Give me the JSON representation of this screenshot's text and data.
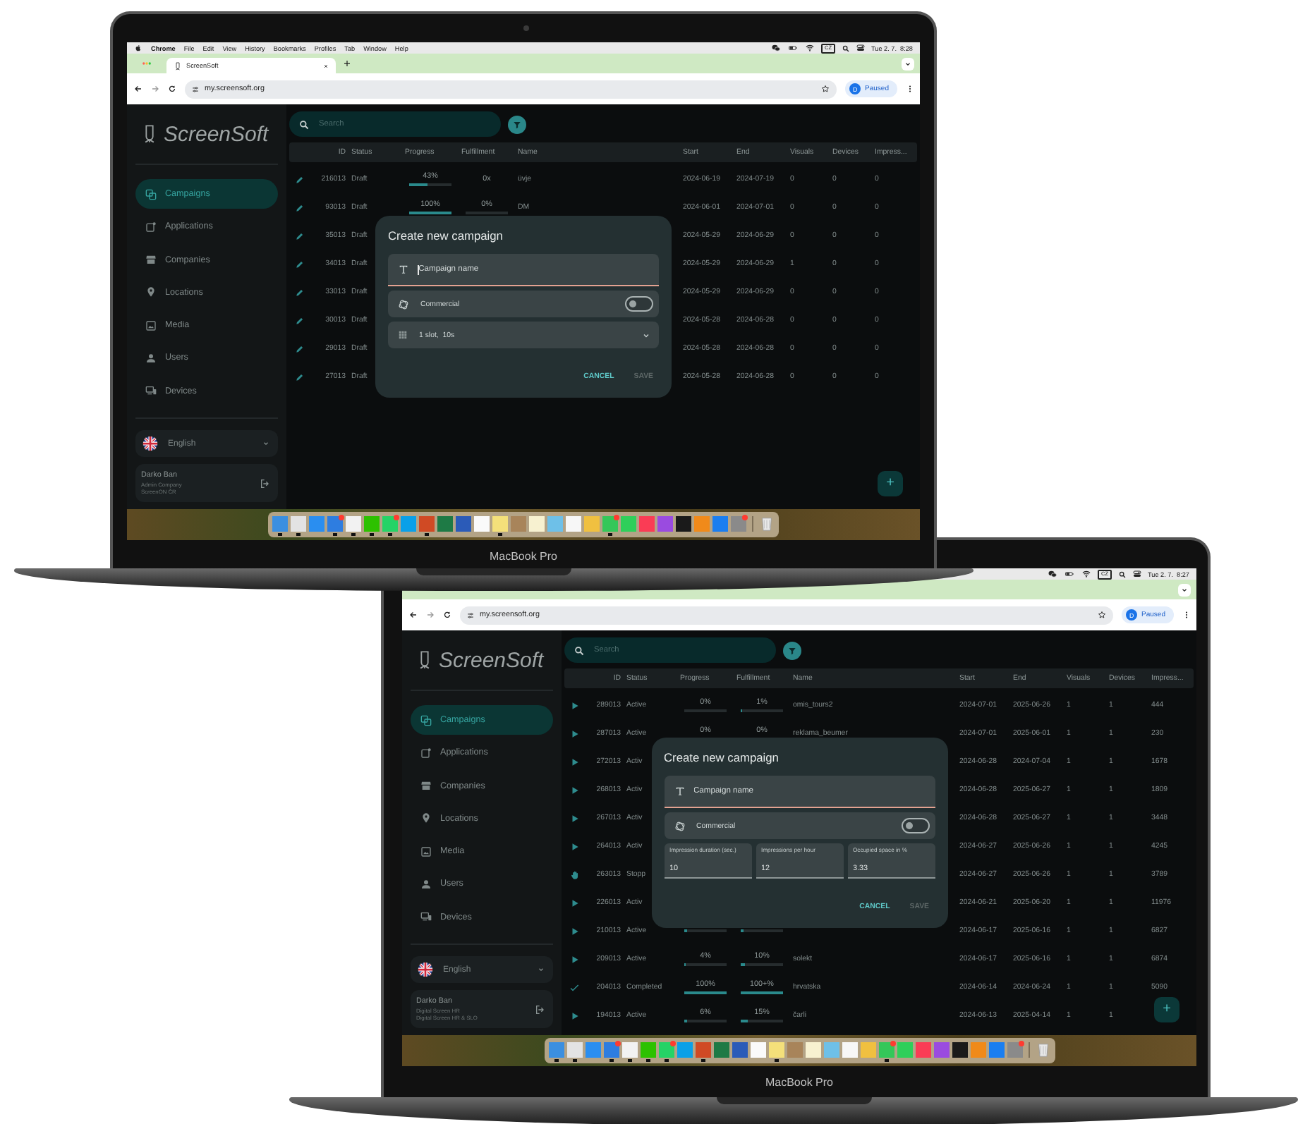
{
  "laptops": [
    {
      "model": "MacBook Pro",
      "menu_bar": {
        "menus": [
          "Chrome",
          "File",
          "Edit",
          "View",
          "History",
          "Bookmarks",
          "Profiles",
          "Tab",
          "Window",
          "Help"
        ],
        "input_source": "CZ",
        "clock": "Tue 2. 7.  8:28"
      },
      "browser": {
        "tabs": [
          {
            "title": "ScreenSoft",
            "selected": true
          }
        ],
        "url": "my.screensoft.org",
        "profile": {
          "initial": "D",
          "label": "Paused"
        }
      },
      "app": {
        "logo": "ScreenSoft",
        "nav": [
          {
            "label": "Campaigns",
            "selected": true
          },
          {
            "label": "Applications",
            "selected": false
          },
          {
            "label": "Companies",
            "selected": false
          },
          {
            "label": "Locations",
            "selected": false
          },
          {
            "label": "Media",
            "selected": false
          },
          {
            "label": "Users",
            "selected": false
          },
          {
            "label": "Devices",
            "selected": false
          }
        ],
        "language": "English",
        "user": {
          "name": "Darko Ban",
          "lines": [
            "Admin Company",
            "ScreenON ČR"
          ]
        },
        "search": {
          "placeholder": "Search"
        },
        "table": {
          "columns": [
            "ID",
            "Status",
            "Progress",
            "Fulfillment",
            "Name",
            "Start",
            "End",
            "Visuals",
            "Devices",
            "Impress..."
          ],
          "rows": [
            {
              "kind": "draft",
              "id": "216013",
              "status": "Draft",
              "progress": {
                "text": "43%",
                "level": 0.43
              },
              "fulfillment": {
                "text": "0x"
              },
              "name": "üvje",
              "start": "2024-06-19",
              "end": "2024-07-19",
              "visuals": "0",
              "devices": "0",
              "impressions": "0"
            },
            {
              "kind": "draft",
              "id": "93013",
              "status": "Draft",
              "progress": {
                "text": "100%",
                "level": 1
              },
              "fulfillment": {
                "text": "0%",
                "level": 0
              },
              "name": "DM",
              "start": "2024-06-01",
              "end": "2024-07-01",
              "visuals": "0",
              "devices": "0",
              "impressions": "0"
            },
            {
              "kind": "draft",
              "id": "35013",
              "status": "Draft",
              "start": "2024-05-29",
              "end": "2024-06-29",
              "visuals": "0",
              "devices": "0",
              "impressions": "0"
            },
            {
              "kind": "draft",
              "id": "34013",
              "status": "Draft",
              "start": "2024-05-29",
              "end": "2024-06-29",
              "visuals": "1",
              "devices": "0",
              "impressions": "0"
            },
            {
              "kind": "draft",
              "id": "33013",
              "status": "Draft",
              "start": "2024-05-29",
              "end": "2024-06-29",
              "visuals": "0",
              "devices": "0",
              "impressions": "0"
            },
            {
              "kind": "draft",
              "id": "30013",
              "status": "Draft",
              "start": "2024-05-28",
              "end": "2024-06-28",
              "visuals": "0",
              "devices": "0",
              "impressions": "0"
            },
            {
              "kind": "draft",
              "id": "29013",
              "status": "Draft",
              "start": "2024-05-28",
              "end": "2024-06-28",
              "visuals": "0",
              "devices": "0",
              "impressions": "0"
            },
            {
              "kind": "draft",
              "id": "27013",
              "status": "Draft",
              "start": "2024-05-28",
              "end": "2024-06-28",
              "visuals": "0",
              "devices": "0",
              "impressions": "0"
            }
          ]
        },
        "dialog": {
          "title": "Create new campaign",
          "fields": [
            {
              "kind": "text",
              "placeholder": "Campaign name",
              "focused": true
            },
            {
              "kind": "switch",
              "label": "Commercial",
              "on": false
            },
            {
              "kind": "select",
              "value": "1 slot,  10s"
            }
          ],
          "actions": [
            {
              "label": "CANCEL",
              "disabled": false
            },
            {
              "label": "SAVE",
              "disabled": true
            }
          ]
        },
        "fab": {
          "symbol": "+"
        }
      },
      "dock": {
        "apps": [
          {
            "running": true,
            "badge": false
          },
          {
            "running": true,
            "badge": false
          },
          {
            "running": false,
            "badge": false
          },
          {
            "running": true,
            "badge": true
          },
          {
            "running": true,
            "badge": false
          },
          {
            "running": true,
            "badge": false
          },
          {
            "running": true,
            "badge": true
          },
          {
            "running": false,
            "badge": false
          },
          {
            "running": true,
            "badge": false
          },
          {
            "running": false,
            "badge": false
          },
          {
            "running": false,
            "badge": false
          },
          {
            "running": false,
            "badge": false
          },
          {
            "running": true,
            "badge": false
          },
          {
            "running": false,
            "badge": false
          },
          {
            "running": false,
            "badge": false
          },
          {
            "running": false,
            "badge": false
          },
          {
            "running": false,
            "badge": false
          },
          {
            "running": false,
            "badge": false
          },
          {
            "running": true,
            "badge": true
          },
          {
            "running": false,
            "badge": false
          },
          {
            "running": false,
            "badge": false
          },
          {
            "running": false,
            "badge": false
          },
          {
            "running": false,
            "badge": false
          },
          {
            "running": false,
            "badge": false
          },
          {
            "running": false,
            "badge": false
          },
          {
            "running": false,
            "badge": true
          }
        ]
      }
    },
    {
      "model": "MacBook Pro",
      "menu_bar": {
        "input_source": "CZ",
        "clock": "Tue 2. 7.  8:27"
      },
      "browser": {
        "url": "my.screensoft.org",
        "profile": {
          "initial": "D",
          "label": "Paused"
        }
      },
      "app": {
        "logo": "ScreenSoft",
        "nav": [
          {
            "label": "Campaigns",
            "selected": true
          },
          {
            "label": "Applications",
            "selected": false
          },
          {
            "label": "Companies",
            "selected": false
          },
          {
            "label": "Locations",
            "selected": false
          },
          {
            "label": "Media",
            "selected": false
          },
          {
            "label": "Users",
            "selected": false
          },
          {
            "label": "Devices",
            "selected": false
          }
        ],
        "language": "English",
        "user": {
          "name": "Darko Ban",
          "lines": [
            "Digital Screen HR",
            "Digital Screen HR & SLO"
          ]
        },
        "search": {
          "placeholder": "Search"
        },
        "table": {
          "columns": [
            "ID",
            "Status",
            "Progress",
            "Fulfillment",
            "Name",
            "Start",
            "End",
            "Visuals",
            "Devices",
            "Impress..."
          ],
          "rows": [
            {
              "kind": "active",
              "id": "289013",
              "status": "Active",
              "progress": {
                "text": "0%",
                "level": 0
              },
              "fulfillment": {
                "text": "1%",
                "level": 0.01
              },
              "name": "omis_tours2",
              "start": "2024-07-01",
              "end": "2025-06-26",
              "visuals": "1",
              "devices": "1",
              "impressions": "444"
            },
            {
              "kind": "active",
              "id": "287013",
              "status": "Active",
              "progress": {
                "text": "0%",
                "level": 0
              },
              "fulfillment": {
                "text": "0%",
                "level": 0
              },
              "name": "reklama_beumer",
              "start": "2024-07-01",
              "end": "2025-06-01",
              "visuals": "1",
              "devices": "1",
              "impressions": "230"
            },
            {
              "kind": "active",
              "id": "272013",
              "status": "Activ",
              "start": "2024-06-28",
              "end": "2024-07-04",
              "visuals": "1",
              "devices": "1",
              "impressions": "1678"
            },
            {
              "kind": "active",
              "id": "268013",
              "status": "Activ",
              "start": "2024-06-28",
              "end": "2025-06-27",
              "visuals": "1",
              "devices": "1",
              "impressions": "1809"
            },
            {
              "kind": "active",
              "id": "267013",
              "status": "Activ",
              "start": "2024-06-28",
              "end": "2025-06-27",
              "visuals": "1",
              "devices": "1",
              "impressions": "3448"
            },
            {
              "kind": "active",
              "id": "264013",
              "status": "Activ",
              "start": "2024-06-27",
              "end": "2025-06-26",
              "visuals": "1",
              "devices": "1",
              "impressions": "4245"
            },
            {
              "kind": "stopped",
              "id": "263013",
              "status": "Stopp",
              "start": "2024-06-27",
              "end": "2025-06-26",
              "visuals": "1",
              "devices": "1",
              "impressions": "3789"
            },
            {
              "kind": "active",
              "id": "226013",
              "status": "Activ",
              "start": "2024-06-21",
              "end": "2025-06-20",
              "visuals": "1",
              "devices": "1",
              "impressions": "11976"
            },
            {
              "kind": "active",
              "id": "210013",
              "status": "Active",
              "progress": {
                "level": 0.05
              },
              "fulfillment": {
                "level": 0.08
              },
              "start": "2024-06-17",
              "end": "2025-06-16",
              "visuals": "1",
              "devices": "1",
              "impressions": "6827"
            },
            {
              "kind": "active",
              "id": "209013",
              "status": "Active",
              "progress": {
                "text": "4%",
                "level": 0.04
              },
              "fulfillment": {
                "text": "10%",
                "level": 0.1
              },
              "name": "solekt",
              "start": "2024-06-17",
              "end": "2025-06-16",
              "visuals": "1",
              "devices": "1",
              "impressions": "6874"
            },
            {
              "kind": "completed",
              "id": "204013",
              "status": "Completed",
              "progress": {
                "text": "100%",
                "level": 1
              },
              "fulfillment": {
                "text": "100+%",
                "level": 1
              },
              "name": "hrvatska",
              "start": "2024-06-14",
              "end": "2024-06-24",
              "visuals": "1",
              "devices": "1",
              "impressions": "5090"
            },
            {
              "kind": "active",
              "id": "194013",
              "status": "Active",
              "progress": {
                "text": "6%",
                "level": 0.06
              },
              "fulfillment": {
                "text": "15%",
                "level": 0.15
              },
              "name": "čarli",
              "start": "2024-06-13",
              "end": "2025-04-14",
              "visuals": "1",
              "devices": "1"
            }
          ]
        },
        "dialog": {
          "title": "Create new campaign",
          "fields": [
            {
              "kind": "text",
              "placeholder": "Campaign name",
              "focused": false
            },
            {
              "kind": "switch",
              "label": "Commercial",
              "on": false
            },
            {
              "kind": "group",
              "fields": [
                {
                  "label": "Impression duration (sec.)",
                  "value": "10"
                },
                {
                  "label": "Impressions per hour",
                  "value": "12"
                },
                {
                  "label": "Occupied space in %",
                  "value": "3.33"
                }
              ]
            }
          ],
          "actions": [
            {
              "label": "CANCEL",
              "disabled": false
            },
            {
              "label": "SAVE",
              "disabled": true
            }
          ]
        },
        "fab": {
          "symbol": "+"
        }
      },
      "dock": {
        "apps": [
          {
            "running": true,
            "badge": false
          },
          {
            "running": true,
            "badge": false
          },
          {
            "running": false,
            "badge": false
          },
          {
            "running": true,
            "badge": true
          },
          {
            "running": true,
            "badge": false
          },
          {
            "running": true,
            "badge": false
          },
          {
            "running": true,
            "badge": true
          },
          {
            "running": false,
            "badge": false
          },
          {
            "running": true,
            "badge": false
          },
          {
            "running": false,
            "badge": false
          },
          {
            "running": false,
            "badge": false
          },
          {
            "running": false,
            "badge": false
          },
          {
            "running": true,
            "badge": false
          },
          {
            "running": false,
            "badge": false
          },
          {
            "running": false,
            "badge": false
          },
          {
            "running": false,
            "badge": false
          },
          {
            "running": false,
            "badge": false
          },
          {
            "running": false,
            "badge": false
          },
          {
            "running": true,
            "badge": true
          },
          {
            "running": false,
            "badge": false
          },
          {
            "running": false,
            "badge": false
          },
          {
            "running": false,
            "badge": false
          },
          {
            "running": false,
            "badge": false
          },
          {
            "running": false,
            "badge": false
          },
          {
            "running": false,
            "badge": false
          },
          {
            "running": false,
            "badge": true
          }
        ]
      }
    }
  ]
}
